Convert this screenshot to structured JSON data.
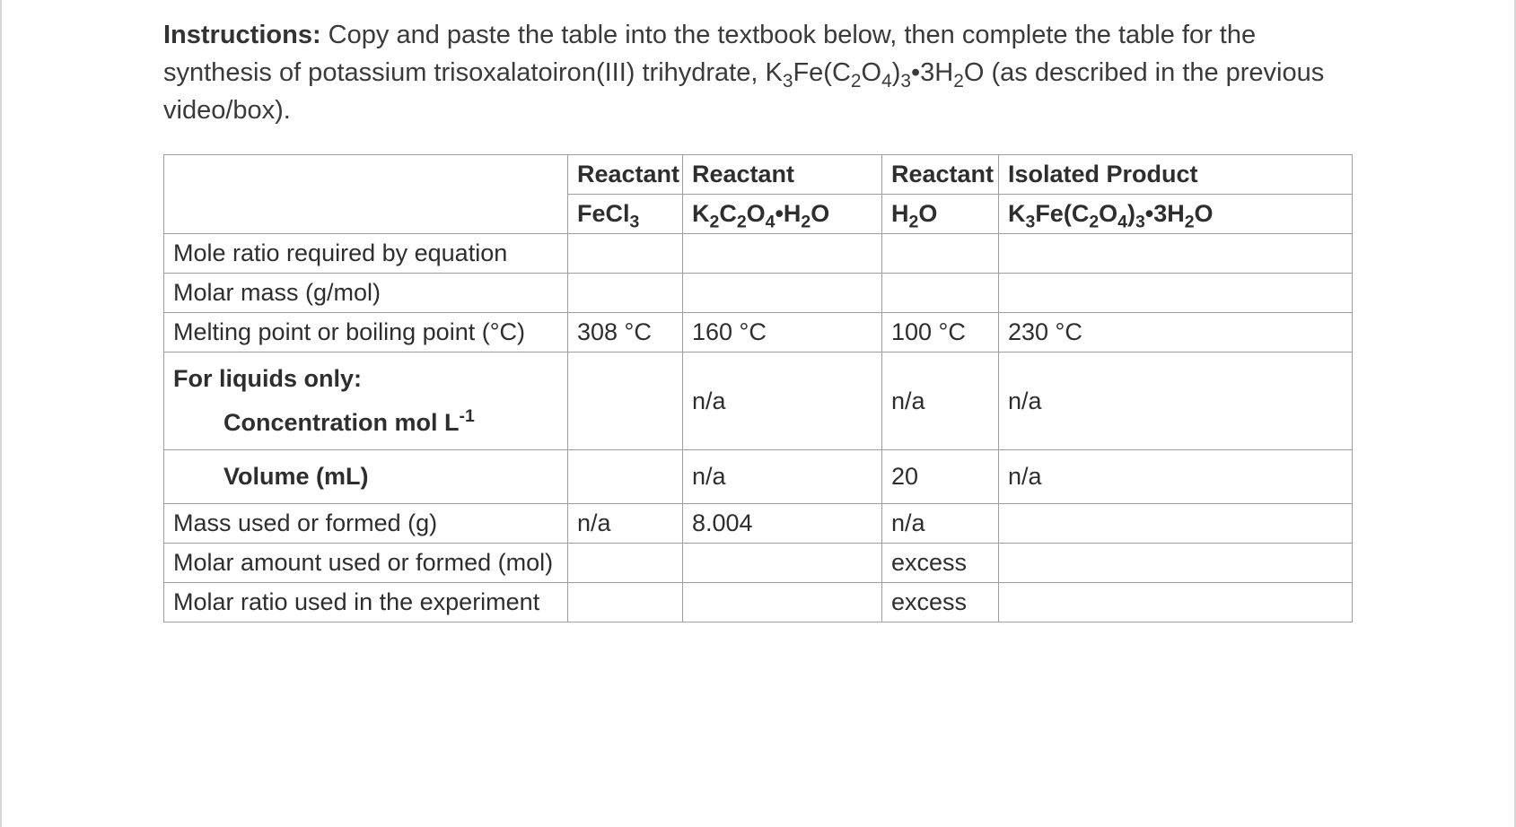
{
  "instructions": {
    "label": "Instructions:",
    "text_before_formula": " Copy and paste the table into the textbook below, then complete the table for the synthesis of potassium trisoxalatoiron(III) trihydrate, ",
    "text_after_formula": " (as described in the previous video/box)."
  },
  "formula_target": {
    "tokens": [
      "K",
      "3",
      "Fe(C",
      "2",
      "O",
      "4",
      ")",
      "3",
      "•3H",
      "2",
      "O"
    ]
  },
  "table": {
    "header_row1": [
      "",
      "Reactant",
      "Reactant",
      "Reactant",
      "Isolated Product"
    ],
    "header_row2_labels": {
      "c1": "FeCl3_formula",
      "c2": "K2C2O4H2O_formula",
      "c3": "H2O_formula",
      "c4": "K3FeC2O43_3H2O_formula"
    },
    "rows": [
      {
        "label": "Mole ratio required by equation",
        "c1": "",
        "c2": "",
        "c3": "",
        "c4": ""
      },
      {
        "label": "Molar mass (g/mol)",
        "c1": "",
        "c2": "",
        "c3": "",
        "c4": ""
      },
      {
        "label": "Melting point or boiling point (°C)",
        "c1": "308 °C",
        "c2": "160 °C",
        "c3": "100 °C",
        "c4": "230 °C"
      },
      {
        "label_liquids_title": "For liquids only:",
        "label_liquids_sub": "Concentration mol L",
        "label_liquids_sub_exp": "-1",
        "c1": "",
        "c2": "n/a",
        "c3": "n/a",
        "c4": "n/a"
      },
      {
        "label": "Volume (mL)",
        "c1": "",
        "c2": "n/a",
        "c3": "20",
        "c4": "n/a"
      },
      {
        "label": "Mass used or formed (g)",
        "c1": "n/a",
        "c2": "8.004",
        "c3": "n/a",
        "c4": ""
      },
      {
        "label": "Molar amount used or formed (mol)",
        "c1": "",
        "c2": "",
        "c3": "excess",
        "c4": ""
      },
      {
        "label": "Molar ratio used in the experiment",
        "c1": "",
        "c2": "",
        "c3": "excess",
        "c4": ""
      }
    ]
  },
  "chem": {
    "FeCl3": "FeCl",
    "FeCl3_sub": "3",
    "K2C2O4H2O_parts": [
      "K",
      "2",
      "C",
      "2",
      "O",
      "4",
      "•H",
      "2",
      "O"
    ],
    "H2O_parts": [
      "H",
      "2",
      "O"
    ],
    "K3FeC2O43_3H2O_parts": [
      "K",
      "3",
      "Fe(C",
      "2",
      "O",
      "4",
      ")",
      "3",
      "•3H",
      "2",
      "O"
    ]
  }
}
